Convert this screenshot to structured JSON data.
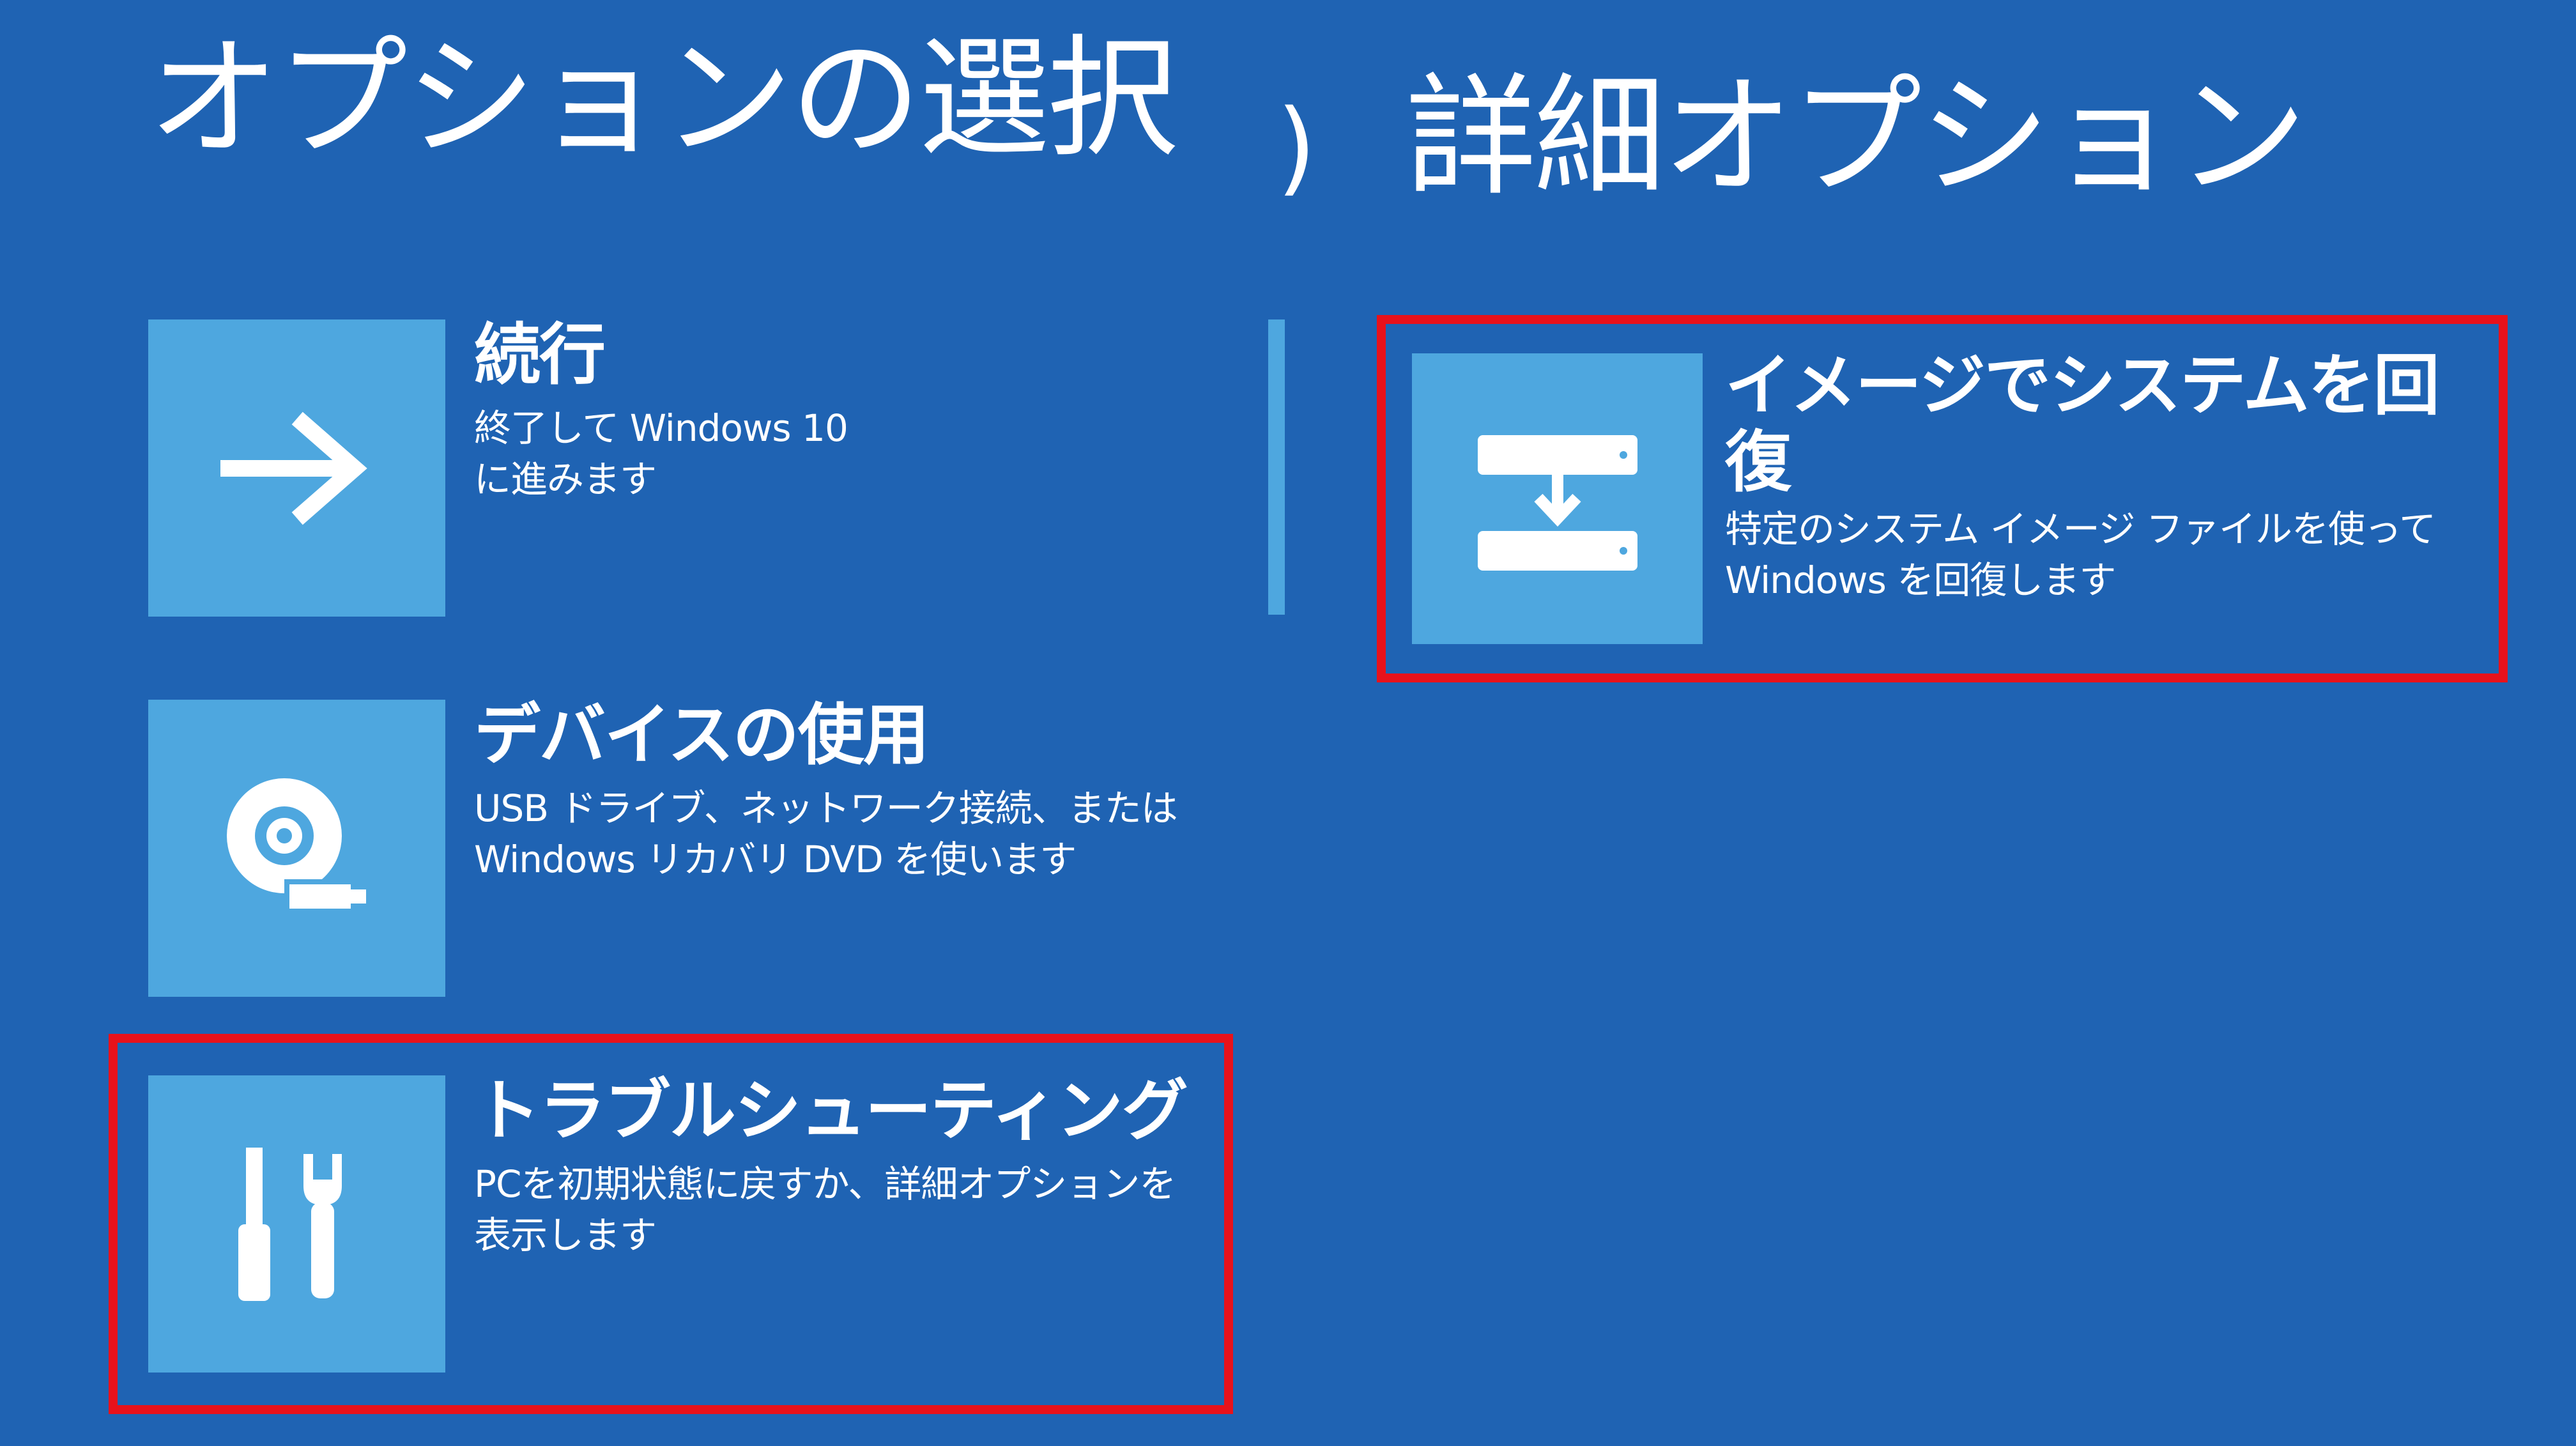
{
  "left_panel": {
    "title": "オプションの選択",
    "options": [
      {
        "title": "続行",
        "description": "終了して Windows 10\nに進みます",
        "icon": "arrow-right-icon"
      },
      {
        "title": "デバイスの使用",
        "description": "USB ドライブ、ネットワーク接続、または\nWindows リカバリ DVD を使います",
        "icon": "disc-usb-icon"
      },
      {
        "title": "トラブルシューティング",
        "description": "PCを初期状態に戻すか、詳細オプションを\n表示します",
        "icon": "tools-icon"
      }
    ]
  },
  "breadcrumb_separator": ")",
  "right_panel": {
    "title": "詳細オプション",
    "options": [
      {
        "title": "イメージでシステムを回\n復",
        "description": "特定のシステム イメージ ファイルを使って\nWindows を回復します",
        "icon": "system-image-restore-icon"
      }
    ]
  },
  "colors": {
    "background": "#1f63b3",
    "tile": "#4ea7df",
    "highlight": "#e8121b",
    "text": "#ffffff"
  }
}
